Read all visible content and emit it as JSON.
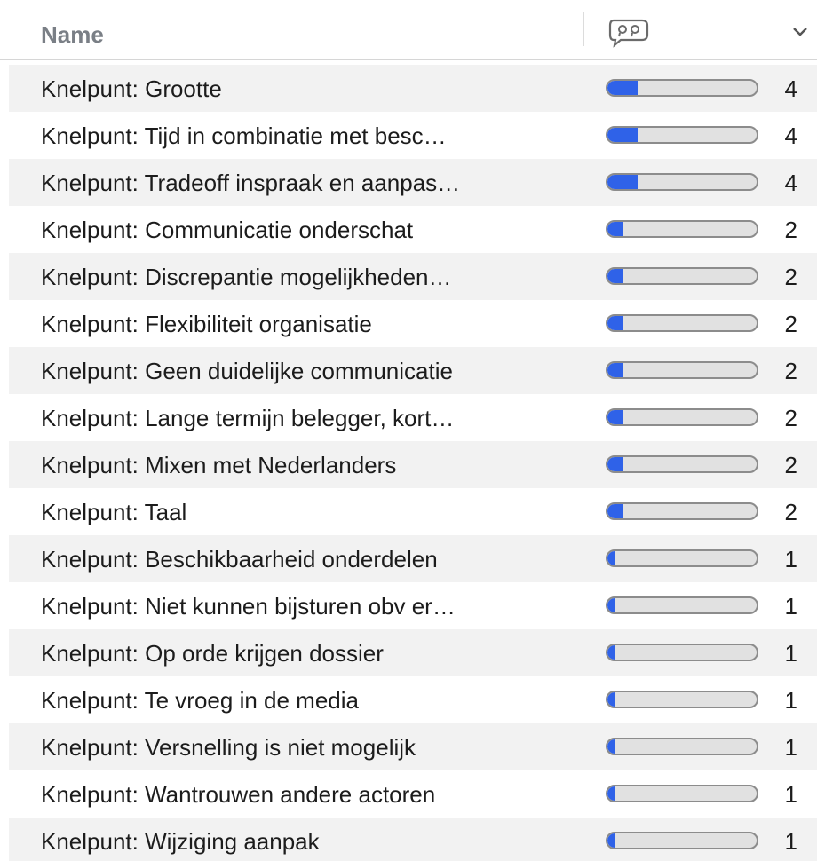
{
  "header": {
    "name_label": "Name",
    "comments_icon": "speech-bubble-quotes-icon",
    "sort_icon": "chevron-down-icon"
  },
  "colors": {
    "bar_fill": "#2f62e8",
    "bar_track": "#e1e1e1",
    "bar_border": "#8c8c8c",
    "row_alt": "#f2f2f2"
  },
  "rows": [
    {
      "label": "Knelpunt: Grootte",
      "count": "4",
      "fill": 0.2
    },
    {
      "label": "Knelpunt: Tijd in combinatie met besc…",
      "count": "4",
      "fill": 0.2
    },
    {
      "label": "Knelpunt: Tradeoff inspraak en aanpas…",
      "count": "4",
      "fill": 0.2
    },
    {
      "label": "Knelpunt: Communicatie onderschat",
      "count": "2",
      "fill": 0.1
    },
    {
      "label": "Knelpunt: Discrepantie mogelijkheden…",
      "count": "2",
      "fill": 0.1
    },
    {
      "label": "Knelpunt: Flexibiliteit organisatie",
      "count": "2",
      "fill": 0.1
    },
    {
      "label": "Knelpunt: Geen duidelijke communicatie",
      "count": "2",
      "fill": 0.1
    },
    {
      "label": "Knelpunt: Lange termijn belegger, kort…",
      "count": "2",
      "fill": 0.1
    },
    {
      "label": "Knelpunt: Mixen met Nederlanders",
      "count": "2",
      "fill": 0.1
    },
    {
      "label": "Knelpunt: Taal",
      "count": "2",
      "fill": 0.1
    },
    {
      "label": "Knelpunt: Beschikbaarheid onderdelen",
      "count": "1",
      "fill": 0.05
    },
    {
      "label": "Knelpunt: Niet kunnen bijsturen obv er…",
      "count": "1",
      "fill": 0.05
    },
    {
      "label": "Knelpunt: Op orde krijgen dossier",
      "count": "1",
      "fill": 0.05
    },
    {
      "label": "Knelpunt: Te vroeg in de media",
      "count": "1",
      "fill": 0.05
    },
    {
      "label": "Knelpunt: Versnelling is niet mogelijk",
      "count": "1",
      "fill": 0.05
    },
    {
      "label": "Knelpunt: Wantrouwen andere actoren",
      "count": "1",
      "fill": 0.05
    },
    {
      "label": "Knelpunt: Wijziging aanpak",
      "count": "1",
      "fill": 0.05
    }
  ]
}
